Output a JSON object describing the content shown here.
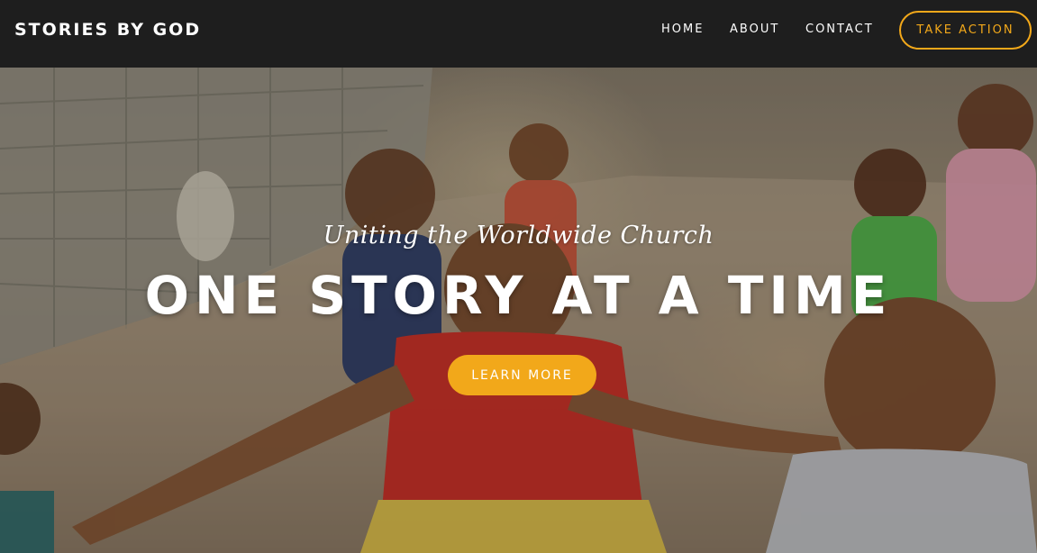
{
  "header": {
    "brand": "STORIES BY GOD",
    "nav": [
      {
        "label": "HOME"
      },
      {
        "label": "ABOUT"
      },
      {
        "label": "CONTACT"
      }
    ],
    "cta_label": "TAKE ACTION"
  },
  "hero": {
    "tagline": "Uniting the Worldwide Church",
    "headline": "ONE STORY AT A TIME",
    "button_label": "LEARN MORE"
  },
  "colors": {
    "accent": "#f2a81a",
    "header_bg": "#1e1e1e",
    "text": "#ffffff"
  }
}
